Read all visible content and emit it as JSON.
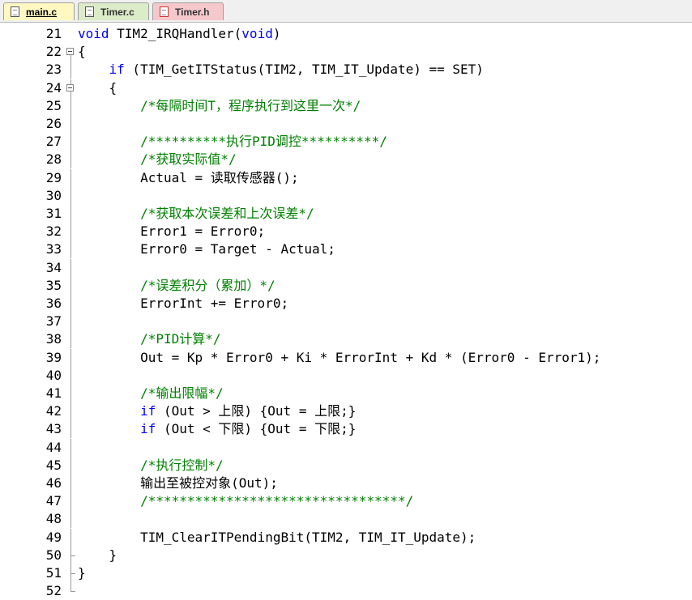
{
  "tabs": [
    {
      "label": "main.c",
      "active": true
    },
    {
      "label": "Timer.c",
      "active": false
    },
    {
      "label": "Timer.h",
      "active": false
    }
  ],
  "colors": {
    "keyword": "#0000ff",
    "comment": "#008000",
    "text": "#000000"
  },
  "code": {
    "lines": [
      {
        "num": "21",
        "indent": "",
        "fold": "none",
        "tokens": [
          {
            "t": "kw",
            "v": "void"
          },
          {
            "t": "tx",
            "v": " TIM2_IRQHandler("
          },
          {
            "t": "kw",
            "v": "void"
          },
          {
            "t": "tx",
            "v": ")"
          }
        ]
      },
      {
        "num": "22",
        "indent": "",
        "fold": "open",
        "tokens": [
          {
            "t": "tx",
            "v": "{"
          }
        ]
      },
      {
        "num": "23",
        "indent": "    ",
        "fold": "line",
        "tokens": [
          {
            "t": "kw",
            "v": "if"
          },
          {
            "t": "tx",
            "v": " (TIM_GetITStatus(TIM2, TIM_IT_Update) == SET)"
          }
        ]
      },
      {
        "num": "24",
        "indent": "    ",
        "fold": "open",
        "tokens": [
          {
            "t": "tx",
            "v": "{"
          }
        ]
      },
      {
        "num": "25",
        "indent": "        ",
        "fold": "line",
        "tokens": [
          {
            "t": "cm",
            "v": "/*每隔时间T，程序执行到这里一次*/"
          }
        ]
      },
      {
        "num": "26",
        "indent": "",
        "fold": "line",
        "tokens": []
      },
      {
        "num": "27",
        "indent": "        ",
        "fold": "line",
        "tokens": [
          {
            "t": "cm",
            "v": "/**********执行PID调控**********/"
          }
        ]
      },
      {
        "num": "28",
        "indent": "        ",
        "fold": "line",
        "tokens": [
          {
            "t": "cm",
            "v": "/*获取实际值*/"
          }
        ]
      },
      {
        "num": "29",
        "indent": "        ",
        "fold": "line",
        "tokens": [
          {
            "t": "tx",
            "v": "Actual = 读取传感器();"
          }
        ]
      },
      {
        "num": "30",
        "indent": "",
        "fold": "line",
        "tokens": []
      },
      {
        "num": "31",
        "indent": "        ",
        "fold": "line",
        "tokens": [
          {
            "t": "cm",
            "v": "/*获取本次误差和上次误差*/"
          }
        ]
      },
      {
        "num": "32",
        "indent": "        ",
        "fold": "line",
        "tokens": [
          {
            "t": "tx",
            "v": "Error1 = Error0;"
          }
        ]
      },
      {
        "num": "33",
        "indent": "        ",
        "fold": "line",
        "tokens": [
          {
            "t": "tx",
            "v": "Error0 = Target - Actual;"
          }
        ]
      },
      {
        "num": "34",
        "indent": "",
        "fold": "line",
        "tokens": []
      },
      {
        "num": "35",
        "indent": "        ",
        "fold": "line",
        "tokens": [
          {
            "t": "cm",
            "v": "/*误差积分（累加）*/"
          }
        ]
      },
      {
        "num": "36",
        "indent": "        ",
        "fold": "line",
        "tokens": [
          {
            "t": "tx",
            "v": "ErrorInt += Error0;"
          }
        ]
      },
      {
        "num": "37",
        "indent": "",
        "fold": "line",
        "tokens": []
      },
      {
        "num": "38",
        "indent": "        ",
        "fold": "line",
        "tokens": [
          {
            "t": "cm",
            "v": "/*PID计算*/"
          }
        ]
      },
      {
        "num": "39",
        "indent": "        ",
        "fold": "line",
        "tokens": [
          {
            "t": "tx",
            "v": "Out = Kp * Error0 + Ki * ErrorInt + Kd * (Error0 - Error1);"
          }
        ]
      },
      {
        "num": "40",
        "indent": "",
        "fold": "line",
        "tokens": []
      },
      {
        "num": "41",
        "indent": "        ",
        "fold": "line",
        "tokens": [
          {
            "t": "cm",
            "v": "/*输出限幅*/"
          }
        ]
      },
      {
        "num": "42",
        "indent": "        ",
        "fold": "line",
        "tokens": [
          {
            "t": "kw",
            "v": "if"
          },
          {
            "t": "tx",
            "v": " (Out > 上限) {Out = 上限;}"
          }
        ]
      },
      {
        "num": "43",
        "indent": "        ",
        "fold": "line",
        "tokens": [
          {
            "t": "kw",
            "v": "if"
          },
          {
            "t": "tx",
            "v": " (Out < 下限) {Out = 下限;}"
          }
        ]
      },
      {
        "num": "44",
        "indent": "",
        "fold": "line",
        "tokens": []
      },
      {
        "num": "45",
        "indent": "        ",
        "fold": "line",
        "tokens": [
          {
            "t": "cm",
            "v": "/*执行控制*/"
          }
        ]
      },
      {
        "num": "46",
        "indent": "        ",
        "fold": "line",
        "tokens": [
          {
            "t": "tx",
            "v": "输出至被控对象(Out);"
          }
        ]
      },
      {
        "num": "47",
        "indent": "        ",
        "fold": "line",
        "tokens": [
          {
            "t": "cm",
            "v": "/*********************************/"
          }
        ]
      },
      {
        "num": "48",
        "indent": "",
        "fold": "line",
        "tokens": []
      },
      {
        "num": "49",
        "indent": "        ",
        "fold": "line",
        "tokens": [
          {
            "t": "tx",
            "v": "TIM_ClearITPendingBit(TIM2, TIM_IT_Update);"
          }
        ]
      },
      {
        "num": "50",
        "indent": "    ",
        "fold": "end",
        "tokens": [
          {
            "t": "tx",
            "v": "}"
          }
        ]
      },
      {
        "num": "51",
        "indent": "",
        "fold": "end",
        "tokens": [
          {
            "t": "tx",
            "v": "}"
          }
        ]
      },
      {
        "num": "52",
        "indent": "",
        "fold": "last",
        "tokens": []
      }
    ]
  }
}
